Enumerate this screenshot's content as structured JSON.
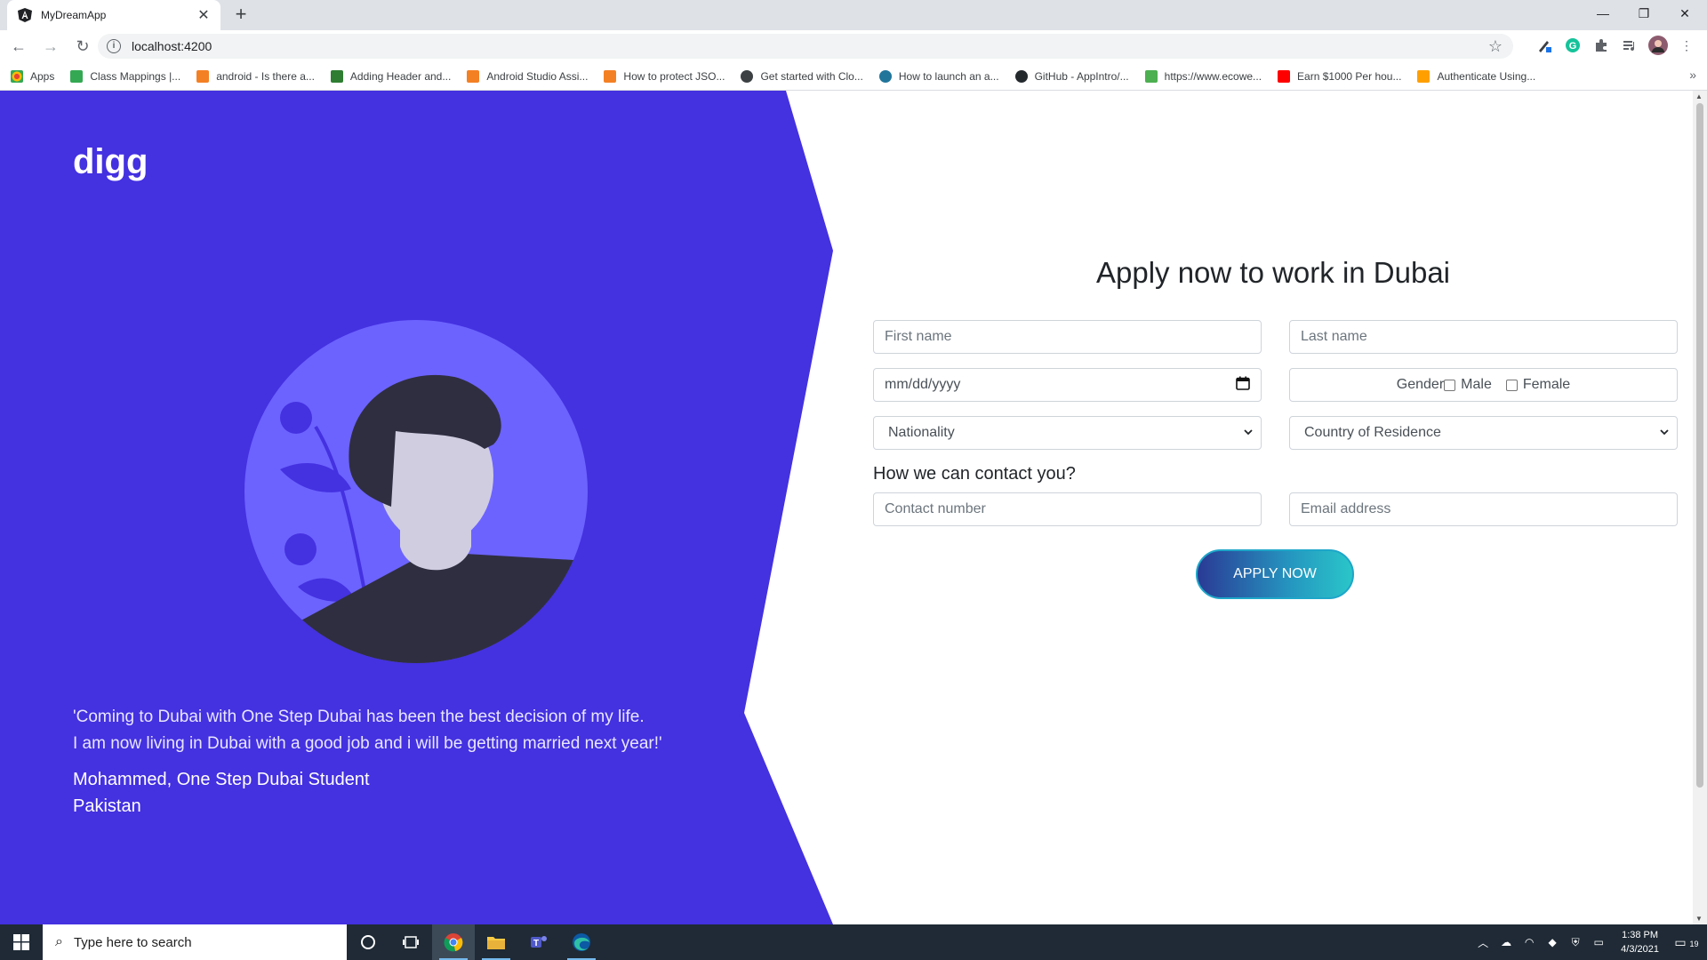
{
  "browser": {
    "tab_title": "MyDreamApp",
    "tab_close": "✕",
    "new_tab": "+",
    "url": "localhost:4200",
    "bookmarks": [
      {
        "label": "Apps",
        "color": "#ea4335"
      },
      {
        "label": "Class Mappings  |...",
        "color": "#34a853"
      },
      {
        "label": "android - Is there a...",
        "color": "#f48024"
      },
      {
        "label": "Adding Header and...",
        "color": "#2e7d32"
      },
      {
        "label": "Android Studio Assi...",
        "color": "#f48024"
      },
      {
        "label": "How to protect JSO...",
        "color": "#f48024"
      },
      {
        "label": "Get started with Clo...",
        "color": "#3c4043"
      },
      {
        "label": "How to launch an a...",
        "color": "#21759b"
      },
      {
        "label": "GitHub - AppIntro/...",
        "color": "#24292e"
      },
      {
        "label": "https://www.ecowe...",
        "color": "#4caf50"
      },
      {
        "label": "Earn $1000 Per hou...",
        "color": "#ff0000"
      },
      {
        "label": "Authenticate Using...",
        "color": "#ffa000"
      }
    ],
    "bookmarks_more": "»"
  },
  "page": {
    "brand": "digg",
    "quote_line1": "'Coming to Dubai with One Step Dubai has been the best decision of my life.",
    "quote_line2": "I am now living in Dubai with a good job and i will be getting married next year!'",
    "author_name": "Mohammed, One Step Dubai Student",
    "author_country": "Pakistan",
    "colors": {
      "panel": "#4431e0",
      "avatar_bg": "#6c63ff"
    }
  },
  "form": {
    "title": "Apply now to work in Dubai",
    "first_name_placeholder": "First name",
    "last_name_placeholder": "Last name",
    "date_placeholder": "mm/dd/yyyy",
    "gender_label": "Gender",
    "gender_male": "Male",
    "gender_female": "Female",
    "nationality": "Nationality",
    "residence": "Country of Residence",
    "contact_heading": "How we can contact you?",
    "contact_placeholder": "Contact number",
    "email_placeholder": "Email address",
    "submit": "APPLY NOW"
  },
  "taskbar": {
    "search_placeholder": "Type here to search",
    "time": "1:38 PM",
    "date": "4/3/2021",
    "notification_count": "19"
  }
}
